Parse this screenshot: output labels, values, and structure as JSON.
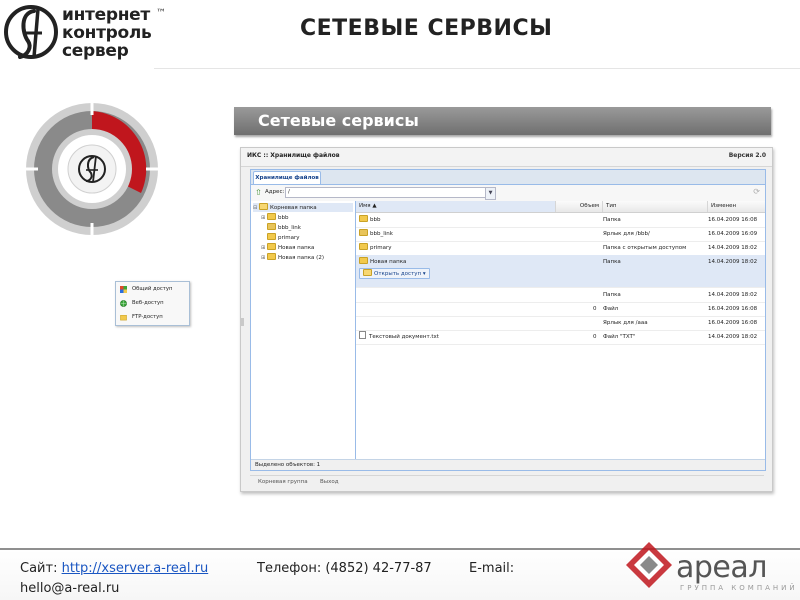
{
  "logo": {
    "line1": "интернет",
    "line2": "контроль",
    "line3": "сервер",
    "tm": "™"
  },
  "page_title": "СЕТЕВЫЕ СЕРВИСЫ",
  "banner": {
    "title": "Сетевые сервисы"
  },
  "app": {
    "title": "ИКС :: Хранилище файлов",
    "version": "Версия 2.0",
    "tab": "Хранилище файлов",
    "address_label": "Адрес:",
    "address_value": "/",
    "tree": [
      {
        "label": "Корневая папка",
        "selected": true
      },
      {
        "label": "bbb"
      },
      {
        "label": "bbb_link"
      },
      {
        "label": "primary"
      },
      {
        "label": "Новая папка"
      },
      {
        "label": "Новая папка (2)"
      }
    ],
    "columns": {
      "name": "Имя ▲",
      "size": "Объем",
      "type": "Тип",
      "modified": "Изменен"
    },
    "rows": [
      {
        "name": "bbb",
        "size": "",
        "type": "Папка",
        "modified": "16.04.2009 16:08"
      },
      {
        "name": "bbb_link",
        "size": "",
        "type": "Ярлык для /bbb/",
        "modified": "16.04.2009 16:09"
      },
      {
        "name": "primary",
        "size": "",
        "type": "Папка с открытым доступом",
        "modified": "14.04.2009 18:02"
      },
      {
        "name": "Новая папка",
        "size": "",
        "type": "Папка",
        "modified": "14.04.2009 18:02",
        "selected": true
      },
      {
        "name": "",
        "size": "",
        "type": "Папка",
        "modified": "14.04.2009 18:02"
      },
      {
        "name": "",
        "size": "0",
        "type": "Файл",
        "modified": "16.04.2009 16:08"
      },
      {
        "name": "",
        "size": "",
        "type": "Ярлык для /aaa",
        "modified": "16.04.2009 16:08"
      },
      {
        "name": "Текстовый документ.txt",
        "size": "0",
        "type": "Файл \"TXT\"",
        "modified": "14.04.2009 18:02"
      }
    ],
    "open_button": "Открыть доступ ▾",
    "menu": [
      {
        "label": "Общий доступ",
        "icon": "shared-icon"
      },
      {
        "label": "Веб-доступ",
        "icon": "globe-icon"
      },
      {
        "label": "FTP-доступ",
        "icon": "ftp-icon"
      }
    ],
    "status": "Выделено объектов: 1",
    "footer": {
      "group": "Корневая группа",
      "exit": "Выход"
    }
  },
  "contacts": {
    "site_label": "Сайт: ",
    "site_url": "http://xserver.a-real.ru",
    "phone": "Телефон: (4852) 42-77-87",
    "email_label": "E-mail:",
    "email": "hello@a-real.ru"
  },
  "areal": {
    "name": "ареал",
    "sub": "ГРУППА КОМПАНИЙ"
  },
  "colors": {
    "accent_red": "#c0161d",
    "banner_gray": "#7e7e7e",
    "link_blue": "#1a56c2",
    "selection": "#dfe8f6"
  }
}
